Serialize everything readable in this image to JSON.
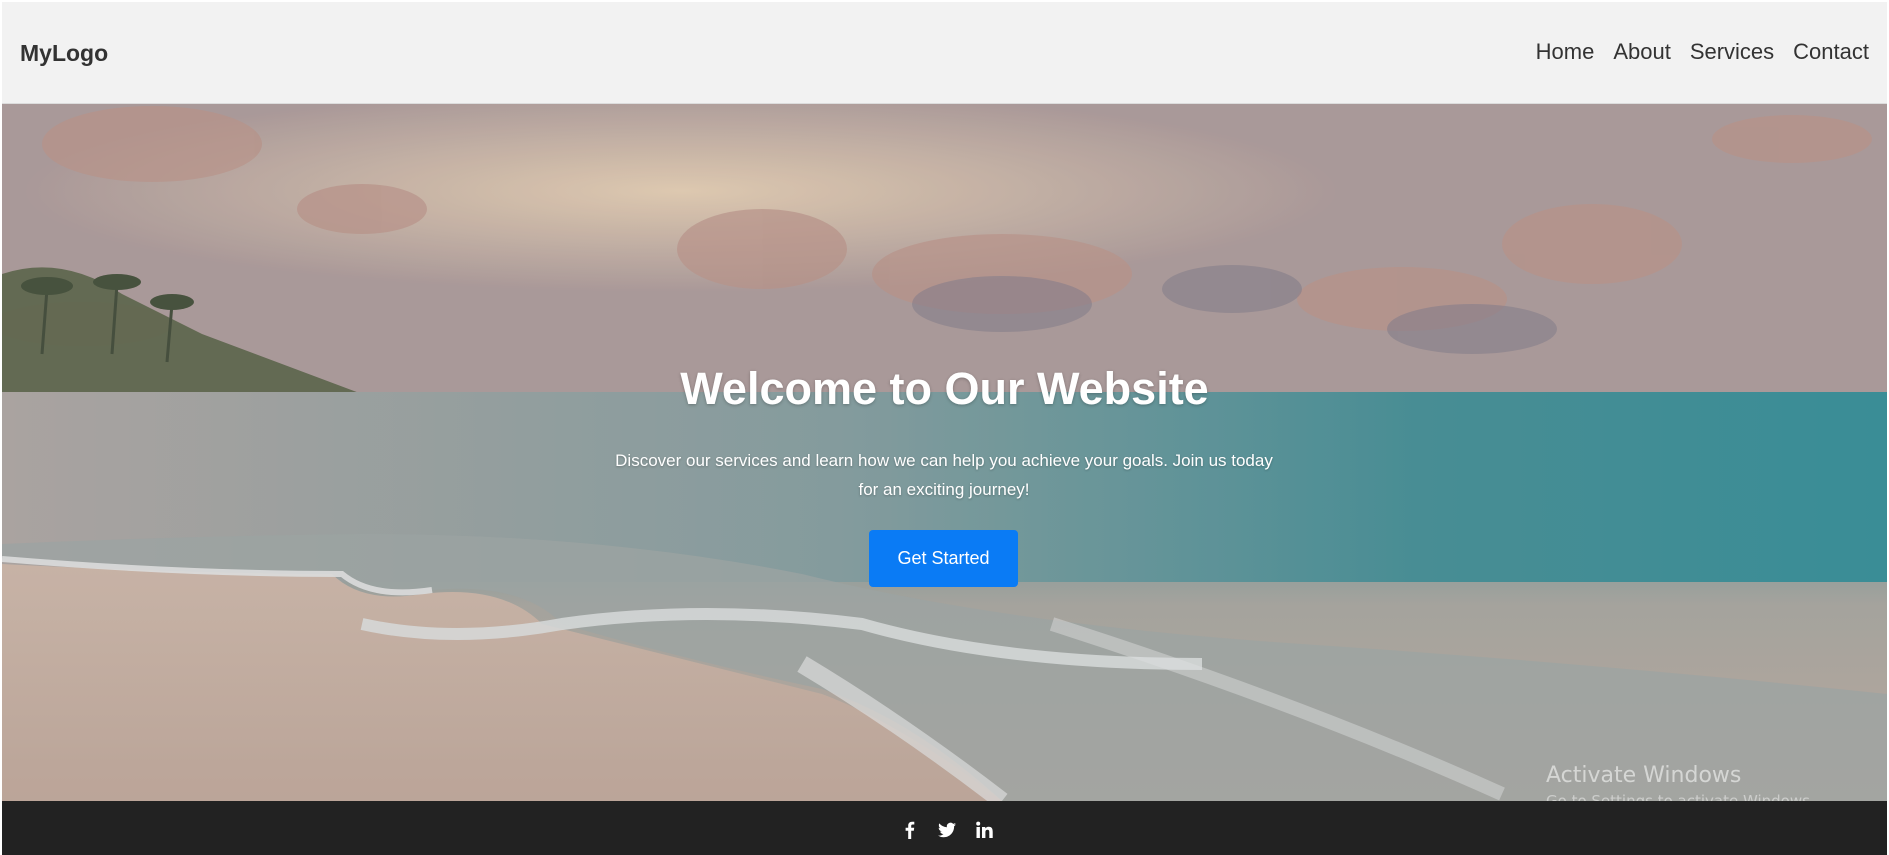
{
  "header": {
    "logo": "MyLogo",
    "nav": [
      "Home",
      "About",
      "Services",
      "Contact"
    ]
  },
  "hero": {
    "title": "Welcome to Our Website",
    "subtitle": "Discover our services and learn how we can help you achieve your goals. Join us today for an exciting journey!",
    "cta_label": "Get Started",
    "background_image": "beach sunset with palm trees and waves"
  },
  "footer": {
    "social_icons": [
      "facebook-icon",
      "twitter-icon",
      "linkedin-icon"
    ]
  },
  "system_watermark": {
    "title": "Activate Windows",
    "subtitle": "Go to Settings to activate Windows."
  },
  "colors": {
    "header_bg": "#f2f2f2",
    "cta_bg": "#0a7bf5",
    "footer_bg": "#222222",
    "text_dark": "#333333"
  }
}
